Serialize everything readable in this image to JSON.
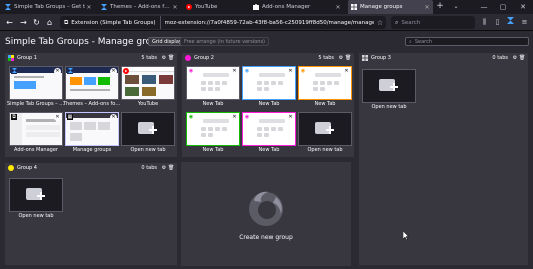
{
  "tabs": [
    {
      "label": "Simple Tab Groups – Get t",
      "icon": "simple-tab-groups-icon",
      "active": false
    },
    {
      "label": "Themes – Add-ons for Fir",
      "icon": "simple-tab-groups-icon",
      "active": false
    },
    {
      "label": "YouTube",
      "icon": "youtube-icon",
      "active": false
    },
    {
      "label": "Add-ons Manager",
      "icon": "puzzle-icon",
      "active": false
    },
    {
      "label": "Manage groups",
      "icon": "grid-icon",
      "active": true
    }
  ],
  "toolbar": {
    "identity": "Extension (Simple Tab Groups)",
    "url": "moz-extension://7a0f4859-72ab-43f8-ba56-c250919ff8d50/manage/manage.html",
    "search_placeholder": "Search"
  },
  "page": {
    "title": "Simple Tab Groups - Manage groups",
    "grid_button": "Grid display",
    "free_button": "Free arrange (in future versions)",
    "search_placeholder": "Search"
  },
  "groups": [
    {
      "name": "Group 1",
      "count": "5 tabs",
      "tabs": [
        {
          "label": "Simple Tab Groups – Get"
        },
        {
          "label": "Themes – Add-ons for Fi"
        },
        {
          "label": "YouTube"
        },
        {
          "label": "Add-ons Manager"
        },
        {
          "label": "Manage groups"
        }
      ],
      "open_new": "Open new tab"
    },
    {
      "name": "Group 2",
      "count": "5 tabs",
      "tabs": [
        {
          "label": "New Tab"
        },
        {
          "label": "New Tab"
        },
        {
          "label": "New Tab"
        },
        {
          "label": "New Tab"
        },
        {
          "label": "New Tab"
        }
      ],
      "open_new": "Open new tab"
    },
    {
      "name": "Group 3",
      "count": "0 tabs",
      "open_new": "Open new tab"
    },
    {
      "name": "Group 4",
      "count": "0 tabs",
      "open_new": "Open new tab"
    }
  ],
  "create_group": "Create new group",
  "colors": {
    "group1": "#ffe900",
    "group2": "#ff1ad9",
    "group3": "#d7d7db",
    "group4": "#fbfbfe",
    "accent": "#c5c5ff"
  }
}
